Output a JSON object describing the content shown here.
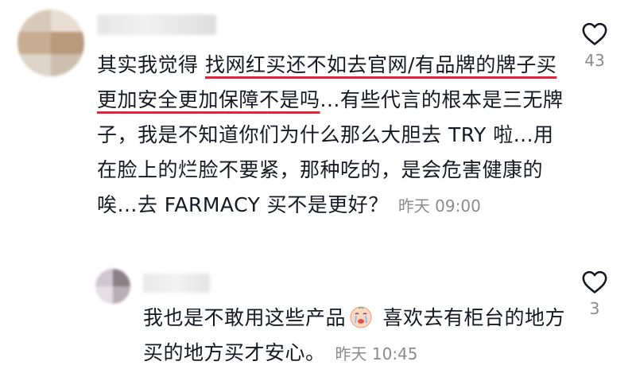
{
  "comments": [
    {
      "text_before_underline": "其实我觉得 ",
      "text_underlined": "找网红买还不如去官网/有品牌的牌子买更加安全更加保障不是吗",
      "text_after": "...有些代言的根本是三无牌子，我是不知道你们为什么那么大胆去 TRY 啦...用在脸上的烂脸不要紧，那种吃的，是会危害健康的唉...去 FARMACY 买不是更好？",
      "timestamp": "昨天 09:00",
      "like_count": "43"
    },
    {
      "text_before_emoji": "我也是不敢用这些产品",
      "emoji_name": "crying-face-emoji",
      "text_after_emoji": " 喜欢去有柜台的地方买的地方买才安心。",
      "timestamp": "昨天 10:45",
      "like_count": "3"
    }
  ],
  "colors": {
    "underline": "#e6233b",
    "meta": "#8a8b91",
    "text": "#161823"
  },
  "icons": {
    "like": "heart-outline-icon"
  }
}
